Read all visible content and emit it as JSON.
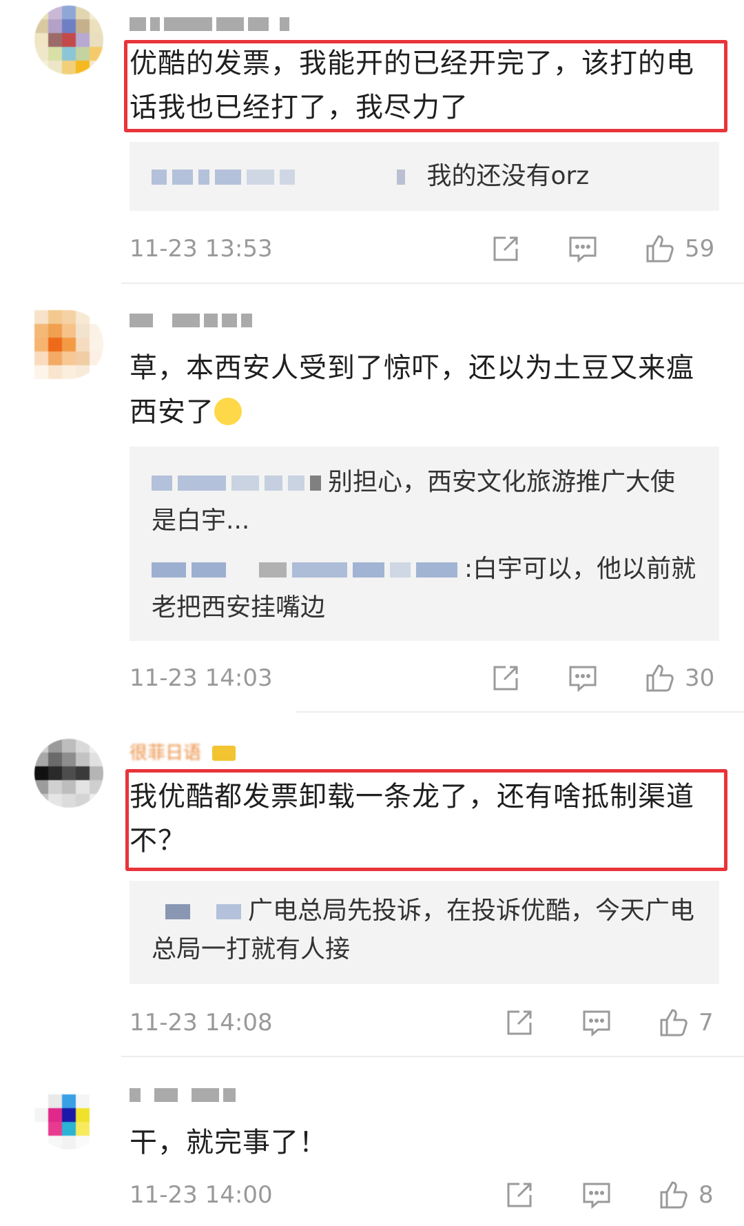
{
  "comments": [
    {
      "text": "优酷的发票，我能开的已经开完了，该打的电话我也已经打了，我尽力了",
      "replies": [
        {
          "text": "我的还没有orz"
        }
      ],
      "time": "11-23 13:53",
      "likes": "59"
    },
    {
      "text": "草，本西安人受到了惊吓，还以为土豆又来瘟西安了",
      "replies": [
        {
          "text": "别担心，西安文化旅游推广大使是白宇..."
        },
        {
          "text": ":白宇可以，他以前就老把西安挂嘴边"
        }
      ],
      "time": "11-23 14:03",
      "likes": "30"
    },
    {
      "username_tag": "很菲日语",
      "text": "我优酷都发票卸载一条龙了，还有啥抵制渠道不？",
      "replies": [
        {
          "text": "广电总局先投诉，在投诉优酷，今天广电总局一打就有人接"
        }
      ],
      "time": "11-23 14:08",
      "likes": "7"
    },
    {
      "text": "干，就完事了！",
      "time": "11-23 14:00",
      "likes": "8"
    }
  ],
  "icons": {
    "share": "share-icon",
    "comment": "comment-icon",
    "like": "thumbs-up-icon"
  },
  "colors": {
    "highlight": "#e8343a",
    "meta": "#999999"
  }
}
